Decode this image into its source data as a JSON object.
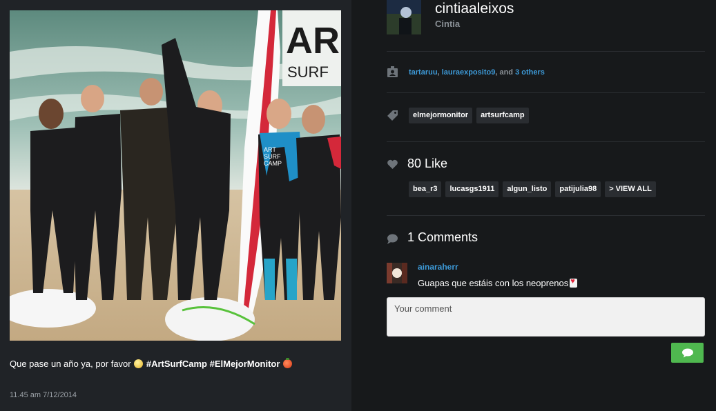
{
  "post": {
    "caption_text": "Que pase un año ya, por favor ",
    "caption_tags": "#ArtSurfCamp #ElMejorMonitor",
    "timestamp": "11.45 am 7/12/2014",
    "photo_sign_lines": [
      "AR",
      "SURF"
    ],
    "board_sticker_lines": [
      "ART",
      "SURF",
      "CAMP"
    ]
  },
  "author": {
    "username": "cintiaaleixos",
    "fullname": "Cintia"
  },
  "tagged": {
    "users": [
      "tartaruu",
      "lauraexposito9"
    ],
    "separator": ",",
    "conjunction": "and",
    "others_label": "3 others"
  },
  "hashtags": [
    "elmejormonitor",
    "artsurfcamp"
  ],
  "likes": {
    "count_label": "80 Like",
    "users": [
      "bea_r3",
      "lucasgs1911",
      "algun_listo",
      "patijulia98"
    ],
    "view_all_label": "> VIEW ALL"
  },
  "comments": {
    "count_label": "1 Comments",
    "items": [
      {
        "user": "ainaraherr",
        "text": "Guapas que estáis con los neoprenos"
      }
    ],
    "input_placeholder": "Your comment"
  },
  "icons": {
    "tagged": "person-tag-icon",
    "hashtag": "tag-icon",
    "like": "heart-icon",
    "comment": "speech-bubble-icon",
    "send": "speech-bubble-icon"
  },
  "colors": {
    "link": "#3d9ad8",
    "send_button": "#4fb84f",
    "panel_left": "#202327",
    "panel_right": "#17191b"
  }
}
